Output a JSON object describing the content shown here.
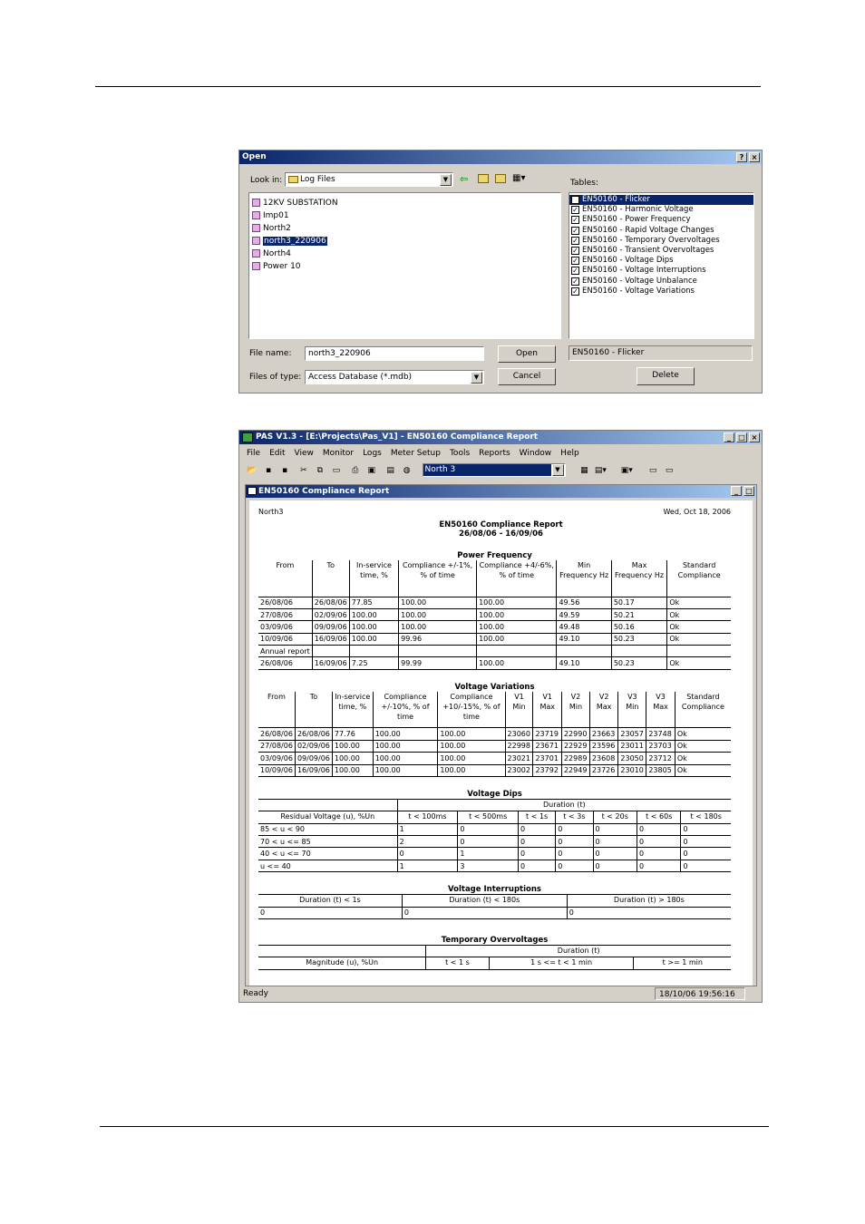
{
  "open_dialog": {
    "title": "Open",
    "help": "?",
    "close": "×",
    "look_in_label": "Look in:",
    "look_in_value": "Log Files",
    "files": [
      "12KV SUBSTATION",
      "Imp01",
      "North2",
      "north3_220906",
      "North4",
      "Power 10"
    ],
    "selected_file": "north3_220906",
    "tables_label": "Tables:",
    "tables": [
      "EN50160 - Flicker",
      "EN50160 - Harmonic Voltage",
      "EN50160 - Power Frequency",
      "EN50160 - Rapid Voltage Changes",
      "EN50160 - Temporary Overvoltages",
      "EN50160 - Transient Overvoltages",
      "EN50160 - Voltage Dips",
      "EN50160 - Voltage Interruptions",
      "EN50160 - Voltage Unbalance",
      "EN50160 - Voltage Variations"
    ],
    "selected_table_display": "EN50160 - Flicker",
    "file_name_label": "File name:",
    "file_name_value": "north3_220906",
    "files_type_label": "Files of type:",
    "files_type_value": "Access Database (*.mdb)",
    "open_button": "Open",
    "cancel_button": "Cancel",
    "delete_button": "Delete"
  },
  "pas_window": {
    "title": "PAS V1.3 - [E:\\Projects\\Pas_V1] - EN50160 Compliance Report",
    "menu": [
      "File",
      "Edit",
      "View",
      "Monitor",
      "Logs",
      "Meter Setup",
      "Tools",
      "Reports",
      "Window",
      "Help"
    ],
    "site_select": "North 3",
    "child_title": "EN50160 Compliance Report",
    "status_left": "Ready",
    "status_time": "18/10/06 19:56:16"
  },
  "report": {
    "site": "North3",
    "date": "Wed, Oct 18, 2006",
    "title": "EN50160 Compliance Report",
    "period": "26/08/06 - 16/09/06",
    "pf": {
      "title": "Power Frequency",
      "headers": [
        "From",
        "To",
        "In-service time, %",
        "Compliance +/-1%, % of time",
        "Compliance +4/-6%, % of time",
        "Min Frequency Hz",
        "Max Frequency Hz",
        "Standard Compliance"
      ],
      "rows": [
        [
          "26/08/06",
          "26/08/06",
          "77.85",
          "100.00",
          "100.00",
          "49.56",
          "50.17",
          "Ok"
        ],
        [
          "27/08/06",
          "02/09/06",
          "100.00",
          "100.00",
          "100.00",
          "49.59",
          "50.21",
          "Ok"
        ],
        [
          "03/09/06",
          "09/09/06",
          "100.00",
          "100.00",
          "100.00",
          "49.48",
          "50.16",
          "Ok"
        ],
        [
          "10/09/06",
          "16/09/06",
          "100.00",
          "99.96",
          "100.00",
          "49.10",
          "50.23",
          "Ok"
        ]
      ],
      "annual_label": "Annual report",
      "annual_row": [
        "26/08/06",
        "16/09/06",
        "7.25",
        "99.99",
        "100.00",
        "49.10",
        "50.23",
        "Ok"
      ]
    },
    "vv": {
      "title": "Voltage Variations",
      "headers": [
        "From",
        "To",
        "In-service time, %",
        "Compliance +/-10%, % of time",
        "Compliance +10/-15%, % of time",
        "V1 Min",
        "V1 Max",
        "V2 Min",
        "V2 Max",
        "V3 Min",
        "V3 Max",
        "Standard Compliance"
      ],
      "rows": [
        [
          "26/08/06",
          "26/08/06",
          "77.76",
          "100.00",
          "100.00",
          "23060",
          "23719",
          "22990",
          "23663",
          "23057",
          "23748",
          "Ok"
        ],
        [
          "27/08/06",
          "02/09/06",
          "100.00",
          "100.00",
          "100.00",
          "22998",
          "23671",
          "22929",
          "23596",
          "23011",
          "23703",
          "Ok"
        ],
        [
          "03/09/06",
          "09/09/06",
          "100.00",
          "100.00",
          "100.00",
          "23021",
          "23701",
          "22989",
          "23608",
          "23050",
          "23712",
          "Ok"
        ],
        [
          "10/09/06",
          "16/09/06",
          "100.00",
          "100.00",
          "100.00",
          "23002",
          "23792",
          "22949",
          "23726",
          "23010",
          "23805",
          "Ok"
        ]
      ]
    },
    "vd": {
      "title": "Voltage Dips",
      "duration_label": "Duration (t)",
      "headers": [
        "Residual Voltage (u), %Un",
        "t < 100ms",
        "t < 500ms",
        "t < 1s",
        "t < 3s",
        "t < 20s",
        "t < 60s",
        "t < 180s"
      ],
      "rows": [
        [
          "85 < u < 90",
          "1",
          "0",
          "0",
          "0",
          "0",
          "0",
          "0"
        ],
        [
          "70 < u <= 85",
          "2",
          "0",
          "0",
          "0",
          "0",
          "0",
          "0"
        ],
        [
          "40 < u <= 70",
          "0",
          "1",
          "0",
          "0",
          "0",
          "0",
          "0"
        ],
        [
          "u <= 40",
          "1",
          "3",
          "0",
          "0",
          "0",
          "0",
          "0"
        ]
      ]
    },
    "vi": {
      "title": "Voltage Interruptions",
      "headers": [
        "Duration (t) < 1s",
        "Duration (t) < 180s",
        "Duration (t) > 180s"
      ],
      "row": [
        "0",
        "0",
        "0"
      ]
    },
    "to": {
      "title": "Temporary Overvoltages",
      "duration_label": "Duration (t)",
      "headers": [
        "Magnitude (u), %Un",
        "t < 1 s",
        "1 s <= t < 1 min",
        "t >= 1 min"
      ]
    }
  }
}
